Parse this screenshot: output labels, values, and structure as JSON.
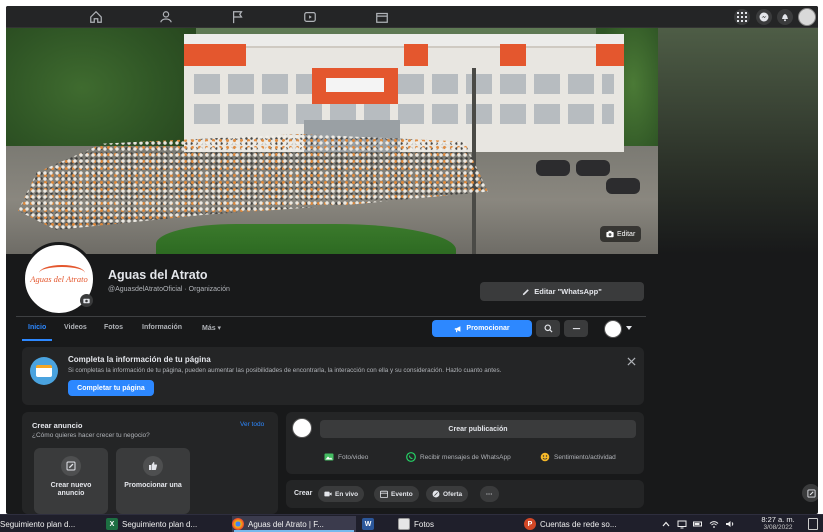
{
  "page": {
    "name": "Aguas del Atrato",
    "handle": "@AguasdelAtratoOficial · Organización",
    "logo_text": "Aguas del Atrato",
    "edit_cover_label": "Editar",
    "whatsapp_button": "Editar \"WhatsApp\""
  },
  "tabs": {
    "items": [
      {
        "label": "Inicio",
        "active": true
      },
      {
        "label": "Videos"
      },
      {
        "label": "Fotos"
      },
      {
        "label": "Información"
      },
      {
        "label": "Más ▾"
      }
    ],
    "promote_button": "Promocionar"
  },
  "banner": {
    "title": "Completa la información de tu página",
    "text": "Si completas la información de tu página, pueden aumentar las posibilidades de encontrarla, la interacción con ella y su consideración. Hazlo cuanto antes.",
    "button": "Completar tu página"
  },
  "ad_card": {
    "title": "Crear anuncio",
    "subtitle": "¿Cómo quieres hacer crecer tu negocio?",
    "see_all": "Ver todo",
    "tiles": [
      {
        "label": "Crear nuevo anuncio"
      },
      {
        "label": "Promocionar una"
      }
    ]
  },
  "post_card": {
    "input_label": "Crear publicación",
    "actions": [
      {
        "label": "Foto/video"
      },
      {
        "label": "Recibir mensajes de WhatsApp"
      },
      {
        "label": "Sentimiento/actividad"
      }
    ]
  },
  "create_bar": {
    "label": "Crear",
    "pills": [
      {
        "label": "En vivo"
      },
      {
        "label": "Evento"
      },
      {
        "label": "Oferta"
      },
      {
        "label": "···"
      }
    ]
  },
  "taskbar": {
    "items": [
      {
        "label": "Seguimiento plan d..."
      },
      {
        "label": "Seguimiento plan d..."
      },
      {
        "label": "Aguas del Atrato | F..."
      },
      {
        "label": "W"
      },
      {
        "label": "Fotos"
      },
      {
        "label": "Cuentas de rede so..."
      }
    ],
    "time": "8:27 a. m.",
    "date": "3/08/2022"
  },
  "colors": {
    "accent": "#2d88ff",
    "surface": "#242526",
    "background": "#18191a",
    "brand_orange": "#e4572e"
  }
}
